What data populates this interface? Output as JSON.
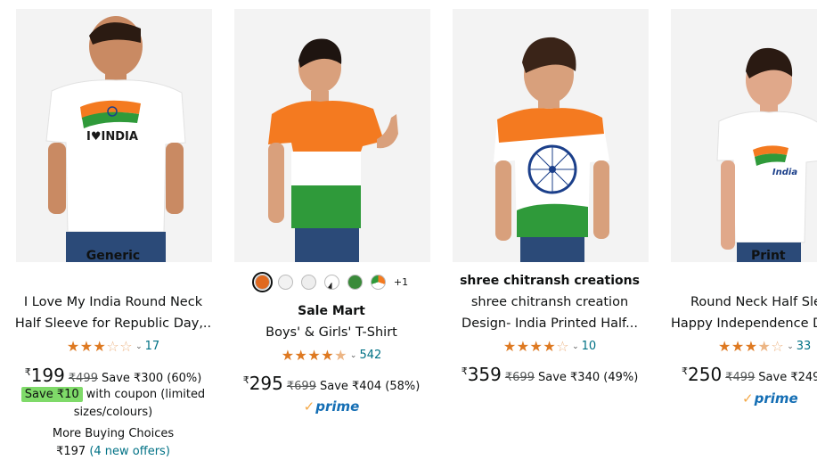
{
  "products": [
    {
      "brand": "Generic",
      "title_line1": "I Love My India Round Neck",
      "title_line2": "Half Sleeve for Republic Day,..",
      "rating_count": "17",
      "rating": 3,
      "price_symbol": "₹",
      "price": "199",
      "mrp": "₹499",
      "save": "Save ₹300 (60%)",
      "coupon_badge": "Save ₹10",
      "coupon_text": "with coupon (limited",
      "coupon_text2": "sizes/colours)",
      "more_buying": "More Buying Choices",
      "offers_price": "₹197",
      "offers_link": "(4 new offers)",
      "shirt_text": "I♥INDIA"
    },
    {
      "brand": "Sale Mart",
      "title_line1": "Boys' & Girls' T-Shirt",
      "rating_count": "542",
      "rating": 4.5,
      "price_symbol": "₹",
      "price": "295",
      "mrp": "₹699",
      "save": "Save ₹404 (58%)",
      "prime": "prime",
      "swatch_more": "+1",
      "swatch_colors": [
        "#e0691f",
        "#f2f2f2",
        "#eeeeee",
        "#ffffff",
        "#3a8a3a",
        "#ffffff"
      ]
    },
    {
      "brand": "shree chitransh creations",
      "title_line1": "shree chitransh creation",
      "title_line2": "Design- India Printed Half...",
      "rating_count": "10",
      "rating": 4,
      "price_symbol": "₹",
      "price": "359",
      "mrp": "₹699",
      "save": "Save ₹340 (49%)"
    },
    {
      "brand": "Print",
      "title_line1": "Round Neck Half Sle",
      "title_line2": "Happy Independence D",
      "rating_count": "33",
      "rating": 3.5,
      "price_symbol": "₹",
      "price": "250",
      "mrp": "₹499",
      "save": "Save ₹249",
      "prime": "prime",
      "shirt_text": "India"
    }
  ],
  "colors": {
    "star": "#de7921",
    "link": "#007185",
    "coupon_bg": "#7fda69",
    "prime": "#146eb4",
    "saffron": "#f47a20",
    "india_green": "#2f9a3a"
  }
}
